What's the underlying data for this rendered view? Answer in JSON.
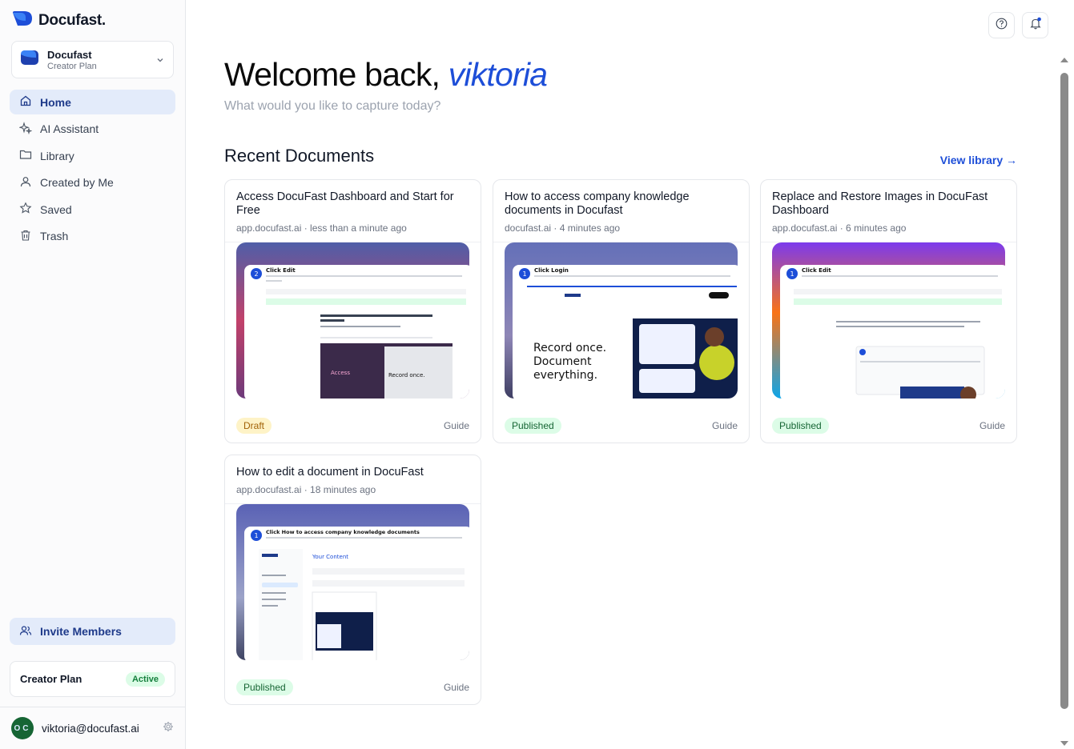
{
  "app": {
    "name": "Docufast."
  },
  "workspace": {
    "name": "Docufast",
    "plan": "Creator Plan"
  },
  "nav": [
    {
      "label": "Home",
      "icon": "home-icon",
      "active": true
    },
    {
      "label": "AI Assistant",
      "icon": "sparkles-icon",
      "active": false
    },
    {
      "label": "Library",
      "icon": "folder-icon",
      "active": false
    },
    {
      "label": "Created by Me",
      "icon": "user-icon",
      "active": false
    },
    {
      "label": "Saved",
      "icon": "star-icon",
      "active": false
    },
    {
      "label": "Trash",
      "icon": "trash-icon",
      "active": false
    }
  ],
  "invite": {
    "label": "Invite Members"
  },
  "plan": {
    "name": "Creator Plan",
    "status": "Active"
  },
  "user": {
    "initials": "OC",
    "email": "viktoria@docufast.ai"
  },
  "header": {
    "welcome_prefix": "Welcome back, ",
    "welcome_name": "viktoria",
    "subtitle": "What would you like to capture today?"
  },
  "recent": {
    "title": "Recent Documents",
    "view_library": "View library →"
  },
  "documents": [
    {
      "title": "Access DocuFast Dashboard and Start for Free",
      "meta": "app.docufast.ai · less than a minute ago",
      "status": "Draft",
      "type": "Guide",
      "thumb_step": "Click Edit"
    },
    {
      "title": "How to access company knowledge documents in Docufast",
      "meta": "docufast.ai · 4 minutes ago",
      "status": "Published",
      "type": "Guide",
      "thumb_step": "Click Login"
    },
    {
      "title": "Replace and Restore Images in DocuFast Dashboard",
      "meta": "app.docufast.ai · 6 minutes ago",
      "status": "Published",
      "type": "Guide",
      "thumb_step": "Click Edit"
    },
    {
      "title": "How to edit a document in DocuFast",
      "meta": "app.docufast.ai · 18 minutes ago",
      "status": "Published",
      "type": "Guide",
      "thumb_step": "Click How to access company knowledge documents"
    }
  ],
  "colors": {
    "accent": "#1d4ed8",
    "active_bg": "#e3ebfa",
    "published": "#166534",
    "draft": "#a16207"
  }
}
